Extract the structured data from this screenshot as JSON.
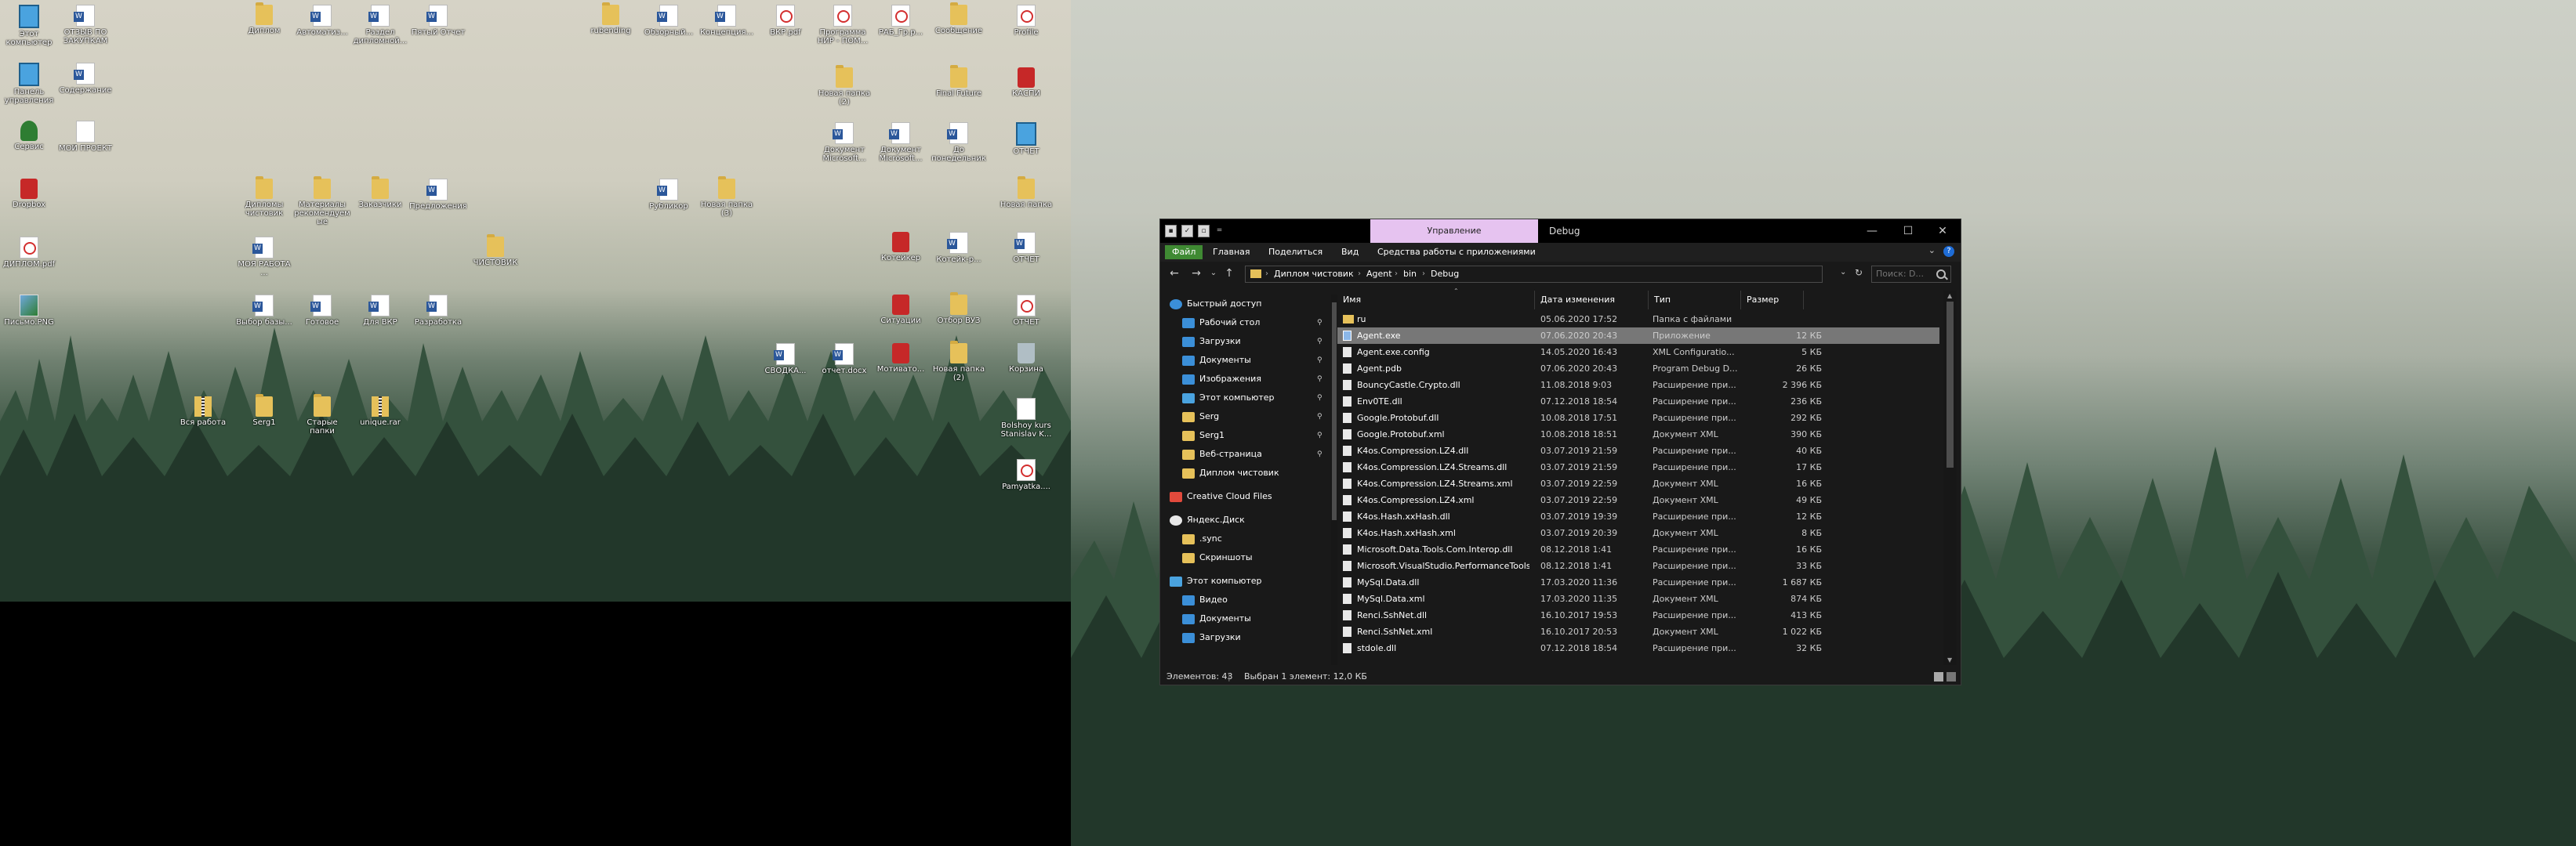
{
  "desktop_left": {
    "icons": [
      {
        "label": "Этот компьютер",
        "type": "pc"
      },
      {
        "label": "ОТЗЫВ ПО ЗАКУПКАМ",
        "type": "word"
      },
      {
        "label": "Диплом",
        "type": "folder"
      },
      {
        "label": "Автоматиз...",
        "type": "word"
      },
      {
        "label": "Раздел дипломной...",
        "type": "word"
      },
      {
        "label": "Пятый Отчет",
        "type": "word"
      },
      {
        "label": "Панель управления",
        "type": "pc"
      },
      {
        "label": "Содержание",
        "type": "word"
      },
      {
        "label": "Сервис",
        "type": "tree"
      },
      {
        "label": "МОЙ ПРОЕКТ",
        "type": "txt"
      },
      {
        "label": "Dropbox",
        "type": "app"
      },
      {
        "label": "Дипломы чистовик",
        "type": "folder"
      },
      {
        "label": "Материалы рекомендуемые",
        "type": "folder"
      },
      {
        "label": "Заказчики",
        "type": "folder"
      },
      {
        "label": "Предложения",
        "type": "word"
      },
      {
        "label": "ДИПЛОМ.pdf",
        "type": "pdf"
      },
      {
        "label": "МОЯ РАБОТА ...",
        "type": "word"
      },
      {
        "label": "ЧИСТОВИК",
        "type": "folder"
      },
      {
        "label": "Письмо.PNG",
        "type": "img"
      },
      {
        "label": "Выбор базы...",
        "type": "word"
      },
      {
        "label": "Готовое",
        "type": "word"
      },
      {
        "label": "Для ВКР",
        "type": "word"
      },
      {
        "label": "Разработка",
        "type": "word"
      },
      {
        "label": "Вся работа",
        "type": "zip"
      },
      {
        "label": "Serg1",
        "type": "folder"
      },
      {
        "label": "Старые папки",
        "type": "folder"
      },
      {
        "label": "unique.rar",
        "type": "zip"
      },
      {
        "label": "rubending",
        "type": "folder"
      },
      {
        "label": "Обзорный...",
        "type": "word"
      },
      {
        "label": "Концепция...",
        "type": "word"
      },
      {
        "label": "ВКР.pdf",
        "type": "pdf"
      },
      {
        "label": "Программа НИР - ПОМ...",
        "type": "pdf"
      },
      {
        "label": "РАБ_Гр.р...",
        "type": "pdf"
      },
      {
        "label": "Сообщение",
        "type": "folder"
      },
      {
        "label": "Profile",
        "type": "pdf"
      },
      {
        "label": "Новая папка (2)",
        "type": "folder"
      },
      {
        "label": "Final Future",
        "type": "folder"
      },
      {
        "label": "КАСПИ",
        "type": "app"
      },
      {
        "label": "Документ Microsoft...",
        "type": "word"
      },
      {
        "label": "Документ Microsoft...",
        "type": "word"
      },
      {
        "label": "До понедельник",
        "type": "word"
      },
      {
        "label": "ОТЧЕТ",
        "type": "pc"
      },
      {
        "label": "Рубликор",
        "type": "word"
      },
      {
        "label": "Новая папка (3)",
        "type": "folder"
      },
      {
        "label": "Новая папка",
        "type": "folder"
      },
      {
        "label": "Котейкер",
        "type": "app"
      },
      {
        "label": "Котейк-р...",
        "type": "word"
      },
      {
        "label": "ОТЧЕТ",
        "type": "word"
      },
      {
        "label": "Ситуации",
        "type": "app"
      },
      {
        "label": "Отбор ВУЗ",
        "type": "folder"
      },
      {
        "label": "ОТЧЕТ",
        "type": "pdf"
      },
      {
        "label": "СВОДКА...",
        "type": "word"
      },
      {
        "label": "отчет.docx",
        "type": "word"
      },
      {
        "label": "Мотивато...",
        "type": "app"
      },
      {
        "label": "Новая папка (2)",
        "type": "folder"
      },
      {
        "label": "Корзина",
        "type": "bin"
      },
      {
        "label": "Bolshoy kurs Stanislav K...",
        "type": "txt"
      },
      {
        "label": "Pamyatka....",
        "type": "pdf"
      }
    ]
  },
  "explorer": {
    "quick_access_icons": [
      "save-icon",
      "properties-icon",
      "new-folder-icon",
      "dropdown-icon"
    ],
    "context_tab": "Управление",
    "title": "Debug",
    "window_buttons": {
      "minimize": "—",
      "maximize": "☐",
      "close": "✕"
    },
    "ribbon_tabs": [
      "Файл",
      "Главная",
      "Поделиться",
      "Вид",
      "Средства работы с приложениями"
    ],
    "help": "?",
    "nav_buttons": {
      "back": "←",
      "forward": "→",
      "recent": "⌄",
      "up": "↑"
    },
    "breadcrumb": [
      "Диплом чистовик",
      "Agent",
      "bin",
      "Debug"
    ],
    "search_placeholder": "Поиск: D...",
    "nav_pane": [
      {
        "label": "Быстрый доступ",
        "icon": "star",
        "pinned": false
      },
      {
        "label": "Рабочий стол",
        "icon": "blue",
        "pinned": true
      },
      {
        "label": "Загрузки",
        "icon": "blue",
        "pinned": true
      },
      {
        "label": "Документы",
        "icon": "blue",
        "pinned": true
      },
      {
        "label": "Изображения",
        "icon": "blue",
        "pinned": true
      },
      {
        "label": "Этот компьютер",
        "icon": "pc",
        "pinned": true
      },
      {
        "label": "Serg",
        "icon": "fold",
        "pinned": true
      },
      {
        "label": "Serg1",
        "icon": "fold",
        "pinned": true
      },
      {
        "label": "Веб-страница",
        "icon": "fold",
        "pinned": true
      },
      {
        "label": "Диплом чистовик",
        "icon": "fold",
        "pinned": false
      },
      {
        "label": "Creative Cloud Files",
        "icon": "cloud",
        "pinned": false
      },
      {
        "label": "Яндекс.Диск",
        "icon": "yd",
        "pinned": false
      },
      {
        "label": ".sync",
        "icon": "fold",
        "pinned": false
      },
      {
        "label": "Скриншоты",
        "icon": "fold",
        "pinned": false
      },
      {
        "label": "Этот компьютер",
        "icon": "pc",
        "pinned": false
      },
      {
        "label": "Видео",
        "icon": "blue",
        "pinned": false
      },
      {
        "label": "Документы",
        "icon": "blue",
        "pinned": false
      },
      {
        "label": "Загрузки",
        "icon": "blue",
        "pinned": false
      }
    ],
    "columns": {
      "name": "Имя",
      "date": "Дата изменения",
      "type": "Тип",
      "size": "Размер"
    },
    "files": [
      {
        "name": "ru",
        "date": "05.06.2020 17:52",
        "type": "Папка с файлами",
        "size": "",
        "icon": "folder"
      },
      {
        "name": "Agent.exe",
        "date": "07.06.2020 20:43",
        "type": "Приложение",
        "size": "12 КБ",
        "icon": "exe",
        "selected": true
      },
      {
        "name": "Agent.exe.config",
        "date": "14.05.2020 16:43",
        "type": "XML Configuratio...",
        "size": "5 КБ",
        "icon": "file"
      },
      {
        "name": "Agent.pdb",
        "date": "07.06.2020 20:43",
        "type": "Program Debug D...",
        "size": "26 КБ",
        "icon": "file"
      },
      {
        "name": "BouncyCastle.Crypto.dll",
        "date": "11.08.2018 9:03",
        "type": "Расширение при...",
        "size": "2 396 КБ",
        "icon": "file"
      },
      {
        "name": "Env0TE.dll",
        "date": "07.12.2018 18:54",
        "type": "Расширение при...",
        "size": "236 КБ",
        "icon": "file"
      },
      {
        "name": "Google.Protobuf.dll",
        "date": "10.08.2018 17:51",
        "type": "Расширение при...",
        "size": "292 КБ",
        "icon": "file"
      },
      {
        "name": "Google.Protobuf.xml",
        "date": "10.08.2018 18:51",
        "type": "Документ XML",
        "size": "390 КБ",
        "icon": "file"
      },
      {
        "name": "K4os.Compression.LZ4.dll",
        "date": "03.07.2019 21:59",
        "type": "Расширение при...",
        "size": "40 КБ",
        "icon": "file"
      },
      {
        "name": "K4os.Compression.LZ4.Streams.dll",
        "date": "03.07.2019 21:59",
        "type": "Расширение при...",
        "size": "17 КБ",
        "icon": "file"
      },
      {
        "name": "K4os.Compression.LZ4.Streams.xml",
        "date": "03.07.2019 22:59",
        "type": "Документ XML",
        "size": "16 КБ",
        "icon": "file"
      },
      {
        "name": "K4os.Compression.LZ4.xml",
        "date": "03.07.2019 22:59",
        "type": "Документ XML",
        "size": "49 КБ",
        "icon": "file"
      },
      {
        "name": "K4os.Hash.xxHash.dll",
        "date": "03.07.2019 19:39",
        "type": "Расширение при...",
        "size": "12 КБ",
        "icon": "file"
      },
      {
        "name": "K4os.Hash.xxHash.xml",
        "date": "03.07.2019 20:39",
        "type": "Документ XML",
        "size": "8 КБ",
        "icon": "file"
      },
      {
        "name": "Microsoft.Data.Tools.Com.Interop.dll",
        "date": "08.12.2018 1:41",
        "type": "Расширение при...",
        "size": "16 КБ",
        "icon": "file"
      },
      {
        "name": "Microsoft.VisualStudio.PerformanceTools...",
        "date": "08.12.2018 1:41",
        "type": "Расширение при...",
        "size": "33 КБ",
        "icon": "file"
      },
      {
        "name": "MySql.Data.dll",
        "date": "17.03.2020 11:36",
        "type": "Расширение при...",
        "size": "1 687 КБ",
        "icon": "file"
      },
      {
        "name": "MySql.Data.xml",
        "date": "17.03.2020 11:35",
        "type": "Документ XML",
        "size": "874 КБ",
        "icon": "file"
      },
      {
        "name": "Renci.SshNet.dll",
        "date": "16.10.2017 19:53",
        "type": "Расширение при...",
        "size": "413 КБ",
        "icon": "file"
      },
      {
        "name": "Renci.SshNet.xml",
        "date": "16.10.2017 20:53",
        "type": "Документ XML",
        "size": "1 022 КБ",
        "icon": "file"
      },
      {
        "name": "stdole.dll",
        "date": "07.12.2018 18:54",
        "type": "Расширение при...",
        "size": "32 КБ",
        "icon": "file"
      }
    ],
    "status": {
      "count": "Элементов: 43",
      "selection": "Выбран 1 элемент: 12,0 КБ"
    }
  }
}
